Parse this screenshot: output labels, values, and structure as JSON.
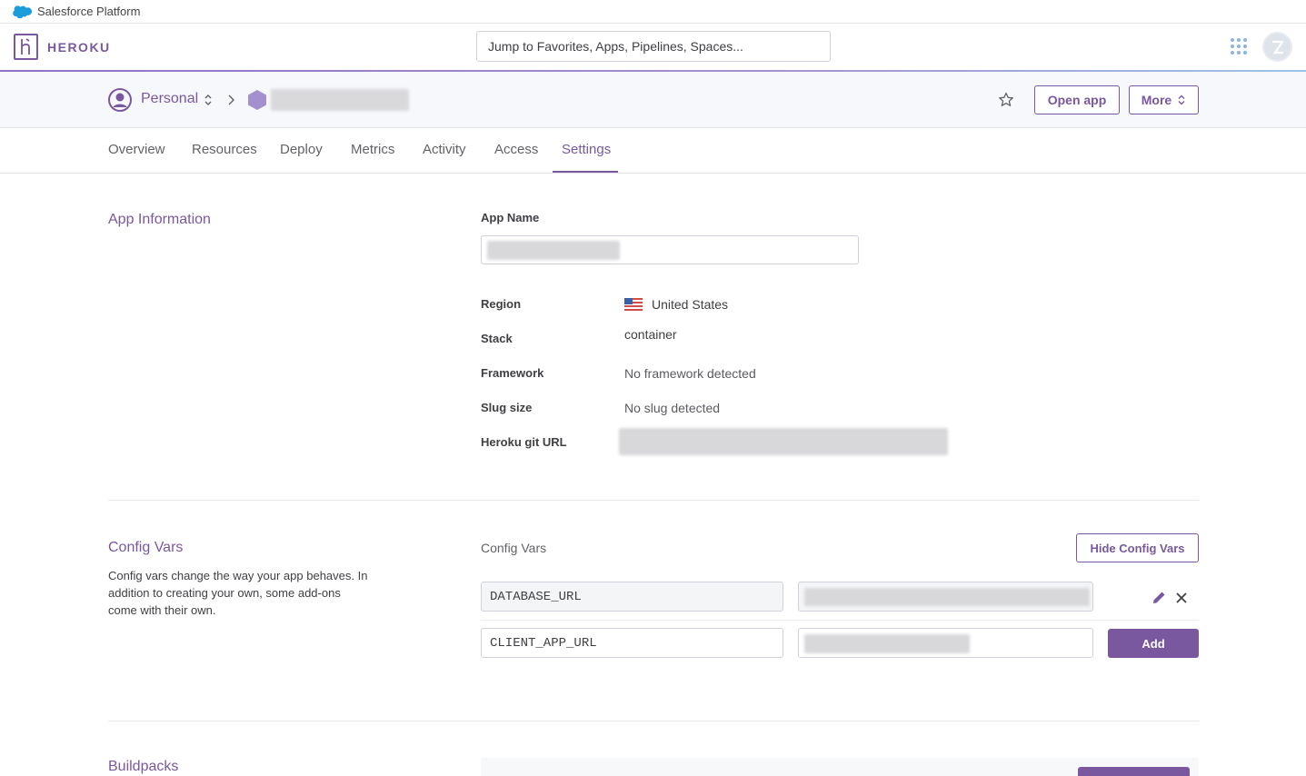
{
  "platform_bar": {
    "label": "Salesforce Platform"
  },
  "header": {
    "logo_text": "HEROKU",
    "search_placeholder": "Jump to Favorites, Apps, Pipelines, Spaces..."
  },
  "app_header": {
    "account": "Personal",
    "open_app_label": "Open app",
    "more_label": "More"
  },
  "tabs": [
    {
      "label": "Overview"
    },
    {
      "label": "Resources"
    },
    {
      "label": "Deploy"
    },
    {
      "label": "Metrics"
    },
    {
      "label": "Activity"
    },
    {
      "label": "Access"
    },
    {
      "label": "Settings",
      "active": true
    }
  ],
  "app_information": {
    "title": "App Information",
    "app_name_label": "App Name",
    "fields": {
      "region_label": "Region",
      "region_value": "United States",
      "stack_label": "Stack",
      "stack_value": "container",
      "framework_label": "Framework",
      "framework_value": "No framework detected",
      "slug_label": "Slug size",
      "slug_value": "No slug detected",
      "git_label": "Heroku git URL"
    }
  },
  "config_vars": {
    "title": "Config Vars",
    "description": "Config vars change the way your app behaves. In addition to creating your own, some add-ons come with their own.",
    "panel_label": "Config Vars",
    "hide_button": "Hide Config Vars",
    "rows": [
      {
        "key": "DATABASE_URL"
      },
      {
        "key": "CLIENT_APP_URL"
      }
    ],
    "add_button": "Add"
  },
  "buildpacks": {
    "title": "Buildpacks"
  },
  "colors": {
    "accent": "#79589f",
    "text": "#3f3f44",
    "border": "#cfd3d9"
  }
}
